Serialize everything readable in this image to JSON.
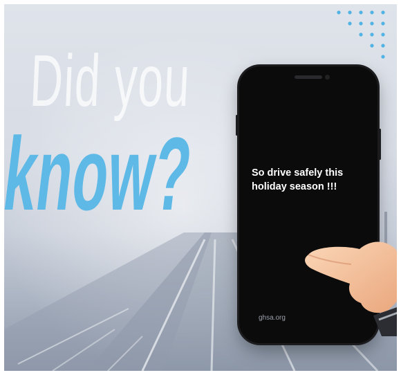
{
  "headline": {
    "line1": "Did you",
    "line2": "know?"
  },
  "phone": {
    "message_line1": "So drive safely this",
    "message_line2": "holiday season !!!",
    "website": "ghsa.org"
  },
  "colors": {
    "accent_blue": "#5fb9e6",
    "phone_body": "#0b0b0c",
    "dots": "#4fb3e3"
  },
  "icons": [
    "dot-grid-decoration",
    "pointing-hand-icon"
  ]
}
